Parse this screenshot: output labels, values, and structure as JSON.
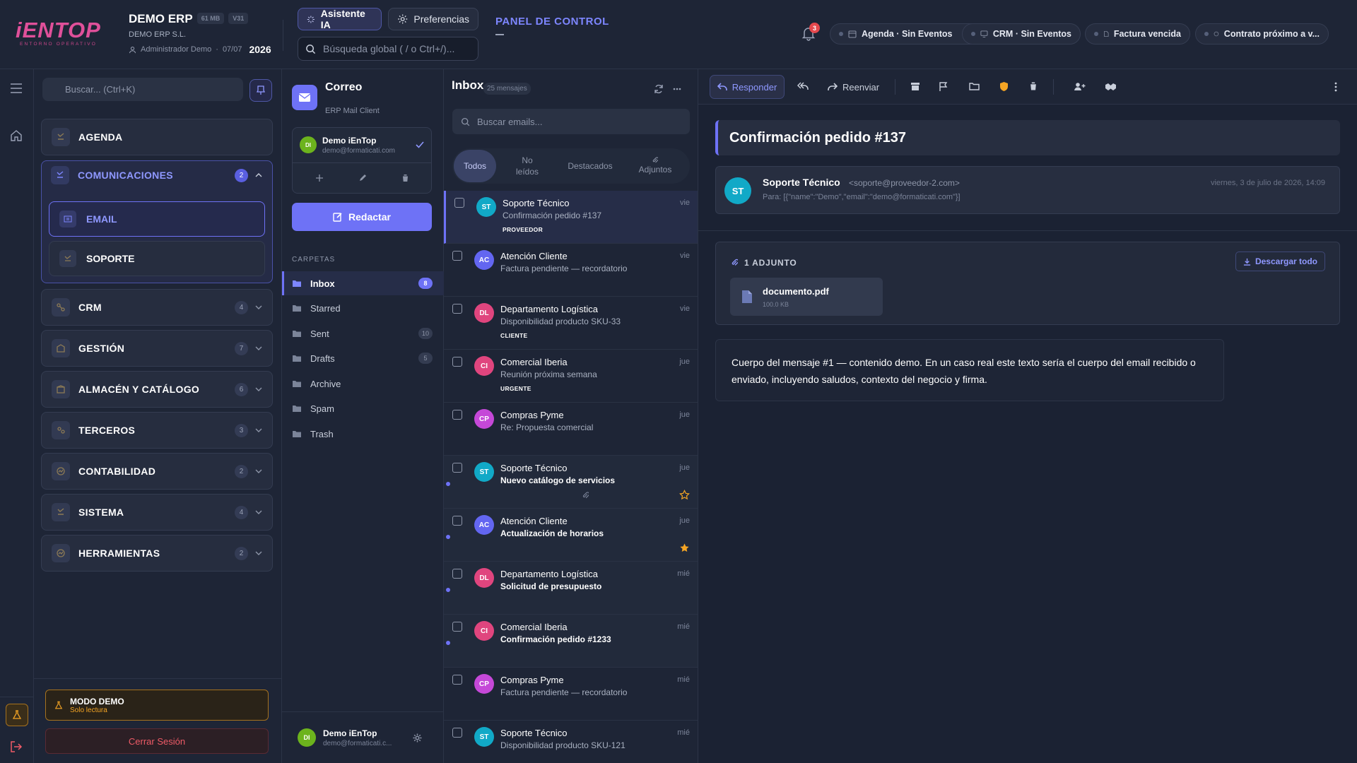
{
  "header": {
    "logo_text": "iENTOP",
    "logo_sub": "ENTORNO OPERATIVO",
    "app_name": "DEMO ERP",
    "size_badge": "61 MB",
    "version_badge": "V31",
    "company": "DEMO ERP S.L.",
    "user": "Administrador Demo",
    "date": "07/07",
    "year": "2026",
    "ai_button": "Asistente IA",
    "prefs_button": "Preferencias",
    "global_search_placeholder": "Búsqueda global ( / o Ctrl+/)...",
    "panel_title": "PANEL DE CONTROL",
    "notif_count": "3",
    "chips": [
      "Agenda · Sin Eventos",
      "CRM · Sin Eventos",
      "Factura vencida",
      "Contrato próximo a v..."
    ]
  },
  "sidebar": {
    "search_placeholder": "Buscar... (Ctrl+K)",
    "items": [
      {
        "label": "AGENDA"
      },
      {
        "label": "COMUNICACIONES",
        "count": "2"
      },
      {
        "label": "CRM",
        "count": "4"
      },
      {
        "label": "GESTIÓN",
        "count": "7"
      },
      {
        "label": "ALMACÉN Y CATÁLOGO",
        "count": "6"
      },
      {
        "label": "TERCEROS",
        "count": "3"
      },
      {
        "label": "CONTABILIDAD",
        "count": "2"
      },
      {
        "label": "SISTEMA",
        "count": "4"
      },
      {
        "label": "HERRAMIENTAS",
        "count": "2"
      }
    ],
    "sub_items": [
      "EMAIL",
      "SOPORTE"
    ],
    "demo_title": "MODO DEMO",
    "demo_sub": "Solo lectura",
    "logout": "Cerrar Sesión"
  },
  "mail": {
    "title": "Correo",
    "subtitle": "ERP Mail Client",
    "account_name": "Demo iEnTop",
    "account_email": "demo@formaticati.com",
    "account_initials": "DI",
    "compose": "Redactar",
    "folders_header": "CARPETAS",
    "folders": [
      {
        "name": "Inbox",
        "count": "8"
      },
      {
        "name": "Starred",
        "count": ""
      },
      {
        "name": "Sent",
        "count": "10"
      },
      {
        "name": "Drafts",
        "count": "5"
      },
      {
        "name": "Archive",
        "count": ""
      },
      {
        "name": "Spam",
        "count": ""
      },
      {
        "name": "Trash",
        "count": ""
      }
    ],
    "footer_name": "Demo iEnTop",
    "footer_email": "demo@formaticati.c..."
  },
  "list": {
    "title": "Inbox",
    "count": "25 mensajes",
    "search_placeholder": "Buscar emails...",
    "tabs": [
      "Todos",
      "No leídos",
      "Destacados",
      "Adjuntos"
    ],
    "messages": [
      {
        "initials": "ST",
        "from": "Soporte Técnico",
        "subject": "Confirmación pedido #137",
        "day": "vie",
        "tag": "PROVEEDOR",
        "color": "#11a9c7",
        "unread": false,
        "starred": false
      },
      {
        "initials": "AC",
        "from": "Atención Cliente",
        "subject": "Factura pendiente — recordatorio",
        "day": "vie",
        "tag": "",
        "color": "#6366f1",
        "unread": false,
        "starred": false
      },
      {
        "initials": "DL",
        "from": "Departamento Logística",
        "subject": "Disponibilidad producto SKU-33",
        "day": "vie",
        "tag": "CLIENTE",
        "color": "#e0457e",
        "unread": false,
        "starred": false
      },
      {
        "initials": "CI",
        "from": "Comercial Iberia",
        "subject": "Reunión próxima semana",
        "day": "jue",
        "tag": "URGENTE",
        "color": "#e0457e",
        "unread": false,
        "starred": false
      },
      {
        "initials": "CP",
        "from": "Compras Pyme",
        "subject": "Re: Propuesta comercial",
        "day": "jue",
        "tag": "",
        "color": "#c548d8",
        "unread": false,
        "starred": false
      },
      {
        "initials": "ST",
        "from": "Soporte Técnico",
        "subject": "Nuevo catálogo de servicios",
        "day": "jue",
        "tag": "",
        "color": "#11a9c7",
        "unread": true,
        "starred": false,
        "attach": true
      },
      {
        "initials": "AC",
        "from": "Atención Cliente",
        "subject": "Actualización de horarios",
        "day": "jue",
        "tag": "",
        "color": "#6366f1",
        "unread": true,
        "starred": true
      },
      {
        "initials": "DL",
        "from": "Departamento Logística",
        "subject": "Solicitud de presupuesto",
        "day": "mié",
        "tag": "",
        "color": "#e0457e",
        "unread": true,
        "starred": false
      },
      {
        "initials": "CI",
        "from": "Comercial Iberia",
        "subject": "Confirmación pedido #1233",
        "day": "mié",
        "tag": "",
        "color": "#e0457e",
        "unread": true,
        "starred": false
      },
      {
        "initials": "CP",
        "from": "Compras Pyme",
        "subject": "Factura pendiente — recordatorio",
        "day": "mié",
        "tag": "",
        "color": "#c548d8",
        "unread": false,
        "starred": false
      },
      {
        "initials": "ST",
        "from": "Soporte Técnico",
        "subject": "Disponibilidad producto SKU-121",
        "day": "mié",
        "tag": "",
        "color": "#11a9c7",
        "unread": false,
        "starred": false
      }
    ]
  },
  "reader": {
    "reply": "Responder",
    "forward": "Reenviar",
    "subject": "Confirmación pedido #137",
    "sender_initials": "ST",
    "sender_name": "Soporte Técnico",
    "sender_email": "<soporte@proveedor-2.com>",
    "to": "Para: [{\"name\":\"Demo\",\"email\":\"demo@formaticati.com\"}]",
    "date": "viernes, 3 de julio de 2026, 14:09",
    "attach_header": "1 ADJUNTO",
    "download_all": "Descargar todo",
    "file_name": "documento.pdf",
    "file_size": "100.0 KB",
    "body": "Cuerpo del mensaje #1 — contenido demo. En un caso real este texto sería el cuerpo del email recibido o enviado, incluyendo saludos, contexto del negocio y firma."
  },
  "colors": {
    "accent": "#6e72f6",
    "brand": "#e0509a",
    "warning": "#f5a524",
    "danger": "#ef5b67"
  }
}
